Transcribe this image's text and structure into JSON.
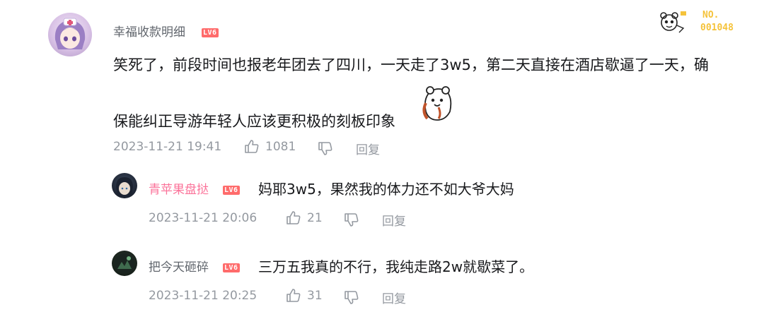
{
  "main_comment": {
    "username": "幸福收款明细",
    "level": "LV6",
    "text_line1": "笑死了，前段时间也报老年团去了四川，一天走了3w5，第二天直接在酒店歇逼了一天，确",
    "text_line2": "保能纠正导游年轻人应该更积极的刻板印象",
    "timestamp": "2023-11-21 19:41",
    "likes": "1081",
    "reply_label": "回复"
  },
  "badge": {
    "label": "NO.",
    "number": "001048"
  },
  "replies": [
    {
      "username": "青苹果盘挞",
      "level": "LV6",
      "text": "妈耶3w5，果然我的体力还不如大爷大妈",
      "timestamp": "2023-11-21 20:06",
      "likes": "21",
      "reply_label": "回复"
    },
    {
      "username": "把今天砸碎",
      "level": "LV6",
      "text": "三万五我真的不行，我纯走路2w就歇菜了。",
      "timestamp": "2023-11-21 20:25",
      "likes": "31",
      "reply_label": "回复"
    }
  ],
  "icons": {
    "like": "thumb-up-icon",
    "dislike": "thumb-down-icon",
    "emoji": "bear-sticker-icon"
  },
  "colors": {
    "pink_username": "#fb7299",
    "gray_meta": "#9499a0",
    "level_badge": "#ff6b6b",
    "badge_gold": "#f5c33b"
  }
}
